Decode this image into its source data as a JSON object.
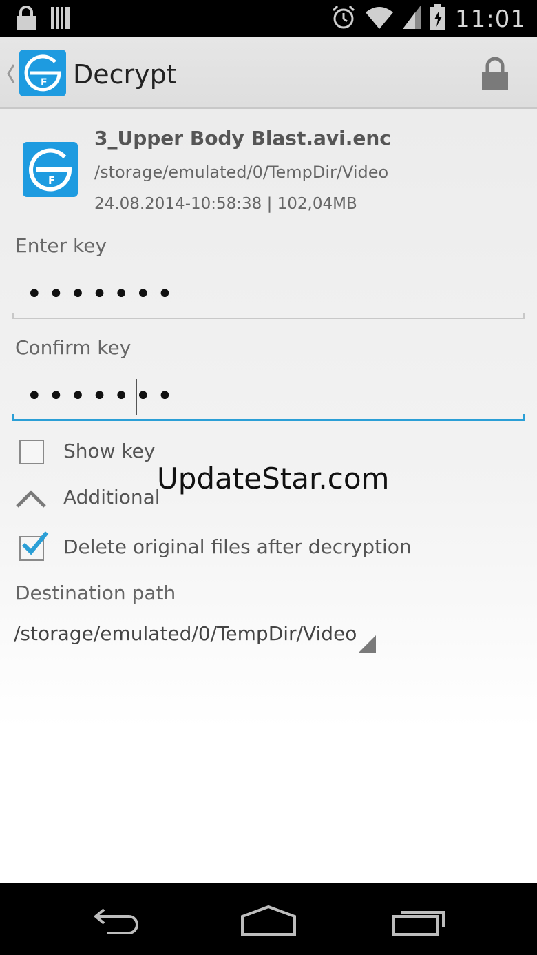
{
  "status_bar": {
    "time": "11:01",
    "icons": [
      "lock-icon",
      "barcode-icon",
      "alarm-icon",
      "wifi-icon",
      "signal-icon",
      "battery-charging-icon"
    ]
  },
  "action_bar": {
    "title": "Decrypt",
    "logo_letter": "F",
    "icons": [
      "chevron-left-icon",
      "app-logo-icon",
      "lock-icon"
    ]
  },
  "file": {
    "name": "3_Upper Body Blast.avi.enc",
    "path": "/storage/emulated/0/TempDir/Video",
    "meta": "24.08.2014-10:58:38 | 102,04MB",
    "logo_letter": "F"
  },
  "form": {
    "enter_key_label": "Enter key",
    "enter_key_value": "•••••••",
    "confirm_key_label": "Confirm key",
    "confirm_key_value": "•••••••",
    "show_key_label": "Show key",
    "show_key_checked": false,
    "additional_label": "Additional",
    "delete_original_label": "Delete original files after decryption",
    "delete_original_checked": true,
    "destination_label": "Destination path",
    "destination_value": "/storage/emulated/0/TempDir/Video"
  },
  "watermark": "UpdateStar.com",
  "colors": {
    "accent": "#2b9fd6",
    "logo_blue": "#1e9be0",
    "status_bar": "#000000",
    "action_bar": "#e2e2e2"
  },
  "nav_bar": {
    "icons": [
      "back-icon",
      "home-icon",
      "recent-apps-icon"
    ]
  }
}
